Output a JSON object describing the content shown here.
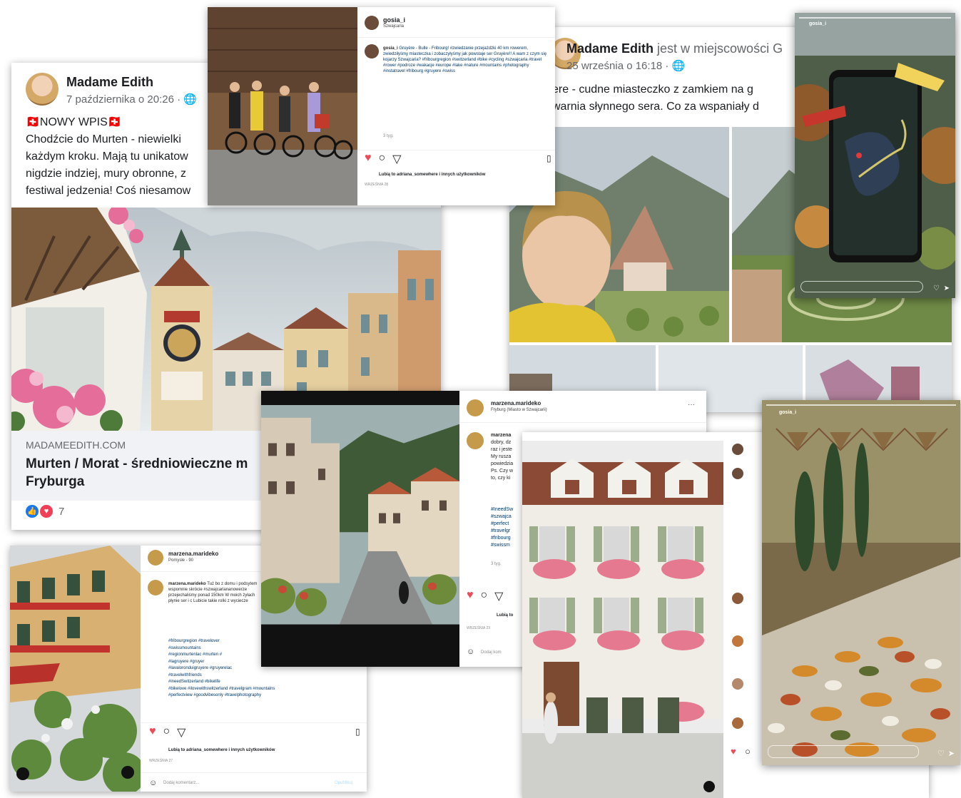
{
  "fb_post_murten": {
    "author": "Madame Edith",
    "date": "7 października o 20:26 · ",
    "headline": "🇨🇭NOWY WPIS🇨🇭",
    "body": "Chodźcie do Murten - niewielki\nkażdym kroku. Mają tu unikatow\nnigdzie indziej, mury obronne, z\nfestiwal jedzenia! Coś niesamow",
    "link_domain": "MADAMEEDITH.COM",
    "link_title": "Murten / Morat - średniowieczne m\nFryburga",
    "reaction_count": "7"
  },
  "fb_post_gruyeres": {
    "author": "Madame Edith",
    "location_text": " jest w miejscowości G",
    "date": "25 września o 16:18 · ",
    "body": "ere - cudne miasteczko z zamkiem na g\nwarnia słynnego sera. Co za wspaniały d"
  },
  "ig_post_bikes": {
    "user": "gosia_i",
    "location": "Szwajcaria",
    "caption_user": "gosia_i",
    "caption": "Gruyère - Bulle - Fribourg! #zwiedzanie przejażdżki 40 km rowerem, zwiedziłyśmy miasteczka i zobaczyłyśmy jak powstaje ser Gruyère!! A wam z czym się kojarzy Szwajcaria? #fribourgregion #switzerland #bike #cycling #szwajcaria #travel #rower #podroze #wakacje #europe #lake #nature #mountains #photography #instatravel #fribourg #gruyere #swiss",
    "time": "3 tyg.",
    "likes": "Lubią to adriana_somewhere i innych użytkowników",
    "date": "WRZEŚNIA 28"
  },
  "ig_post_murten": {
    "user": "marzena.marideko",
    "location": "Pomysłe - 90",
    "caption_user": "marzena.marideko",
    "caption": "Tuż bo z domu i podsytem wspomnie skrócie #szwajcariananowerze przejechaliśmy ponad 150km W moich żyłach płynie ser i c Lubicie takie rolki z wyciecze",
    "hashtags": "#fribourgregion #travelover\n#swissmountains\n#regionmurtenlac #murten #\n#lagruyere #gruyer\n#lavaloronduigruyere #gruyerelac\n#travelwithfriends\n#ineedSwitzerland #bikelife\n#bikelove #ilovewithswitzerland #travelgram #mountains\n#perfectview #goodvibesonly #travelphotography",
    "likes": "Lubią to adriana_somewhere i innych użytkowników",
    "date": "WRZEŚNIA 27",
    "comment_placeholder": "Dodaj komentarz...",
    "publish": "Opublikuj"
  },
  "ig_post_fribourg": {
    "user": "marzena.marideko",
    "location": "Fryburg (Miasto w Szwajcarii)",
    "caption_user": "marzena",
    "caption": "dobry, dz\nraz i jeste\nMy rusza\npowiedzia\nPs. Czy w\nto, czy ki",
    "hashtags": "#IneedSw\n#szwajca\n#perfect\n#travelgr\n#fribourg\n#swissm",
    "time": "3 tyg.",
    "likes": "Lubią to",
    "date": "WRZEŚNIA 23",
    "comment_placeholder": "Dodaj kom"
  },
  "story_map": {
    "user": "gosia_i"
  },
  "story_food": {
    "user": "gosia_i"
  },
  "colors": {
    "fb_blue": "#385898",
    "ig_red": "#ed4956",
    "link": "#00376b"
  }
}
